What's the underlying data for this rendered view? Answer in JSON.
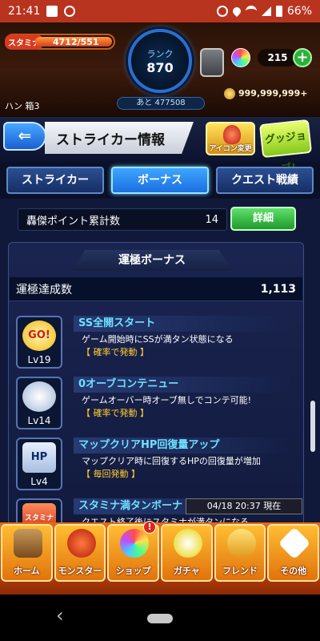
{
  "status_bar": {
    "time": "21:41",
    "battery": "66%"
  },
  "header": {
    "stamina_label": "スタミナ",
    "stamina_value": "4712/551",
    "rank_label": "ランク",
    "rank_value": "870",
    "rank_next": "あと 477508",
    "orb_count": "215",
    "plus_label": "+",
    "coin_count": "999,999,999+",
    "user_name": "ハン 箱3"
  },
  "titlebar": {
    "back_label": "⇐",
    "title": "ストライカー情報",
    "icon_change_label": "アイコン変更",
    "goods_label": "グッジョブ!"
  },
  "tabs": [
    {
      "label": "ストライカー",
      "active": false
    },
    {
      "label": "ボーナス",
      "active": true
    },
    {
      "label": "クエスト戦績",
      "active": false
    }
  ],
  "points": {
    "label": "轟傑ポイント累計数",
    "value": "14",
    "detail_button": "詳細"
  },
  "luck_bonus": {
    "title": "運極ボーナス",
    "count_label": "運極達成数",
    "count_value": "1,113",
    "items": [
      {
        "name": "SS全開スタート",
        "desc": "ゲーム開始時にSSが満タン状態になる",
        "trigger": "【 確率で発動 】",
        "level": "Lv19",
        "icon": "go-icon"
      },
      {
        "name": "0オーブコンテニュー",
        "desc": "ゲームオーバー時オーブ無しでコンテ可能!",
        "trigger": "【 確率で発動 】",
        "level": "Lv14",
        "icon": "wing-arrow-icon"
      },
      {
        "name": "マップクリアHP回復量アップ",
        "desc": "マップクリア時に回復するHPの回復量が増加",
        "trigger": "【 毎回発動 】",
        "level": "Lv4",
        "icon": "hp-icon"
      },
      {
        "name": "スタミナ満タンボーナ",
        "desc": "クエスト終了後にスタミナが満タンになる",
        "trigger": "",
        "level": "",
        "icon": "stamina-icon"
      }
    ],
    "toast": "04/18 20:37 現在"
  },
  "bottom_nav": [
    {
      "label": "ホーム",
      "icon": "home-icon"
    },
    {
      "label": "モンスター",
      "icon": "monster-icon"
    },
    {
      "label": "ショップ",
      "icon": "shop-icon",
      "badge": "!"
    },
    {
      "label": "ガチャ",
      "icon": "gacha-icon"
    },
    {
      "label": "フレンド",
      "icon": "friend-icon"
    },
    {
      "label": "その他",
      "icon": "other-icon"
    }
  ],
  "icon_colors": {
    "go_icon_text": "GO!",
    "hp_icon_text": "HP",
    "stamina_icon_text": "スタミナ"
  },
  "colors": {
    "status_bar": "#b8341f",
    "accent_blue": "#1b6fe1",
    "accent_green": "#1e9a2c",
    "bonus_name": "#6fe0ff",
    "bonus_trigger": "#ffcc33",
    "nav_orange": "#e86913"
  }
}
